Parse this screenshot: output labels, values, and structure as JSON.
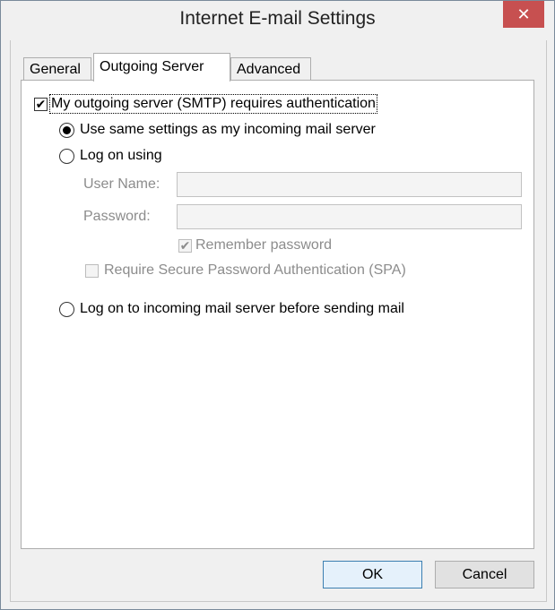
{
  "window": {
    "title": "Internet E-mail Settings",
    "close_glyph": "✕"
  },
  "tabs": [
    {
      "label": "General",
      "active": false
    },
    {
      "label": "Outgoing Server",
      "active": true
    },
    {
      "label": "Advanced",
      "active": false
    }
  ],
  "outgoing": {
    "requires_auth": {
      "label": "My outgoing server (SMTP) requires authentication",
      "checked": true
    },
    "option_same": {
      "label": "Use same settings as my incoming mail server",
      "selected": true
    },
    "option_logon": {
      "label": "Log on using",
      "selected": false
    },
    "username": {
      "label": "User Name:",
      "value": ""
    },
    "password": {
      "label": "Password:",
      "value": ""
    },
    "remember": {
      "label": "Remember password",
      "checked": true,
      "enabled": false
    },
    "spa": {
      "label": "Require Secure Password Authentication (SPA)",
      "checked": false,
      "enabled": false
    },
    "option_incoming_first": {
      "label": "Log on to incoming mail server before sending mail",
      "selected": false
    }
  },
  "buttons": {
    "ok": "OK",
    "cancel": "Cancel"
  },
  "colors": {
    "close_button": "#c75050",
    "dialog_bg": "#f0f0f0",
    "disabled_text": "#8c8c8c",
    "default_button_border": "#3c7fb1"
  }
}
